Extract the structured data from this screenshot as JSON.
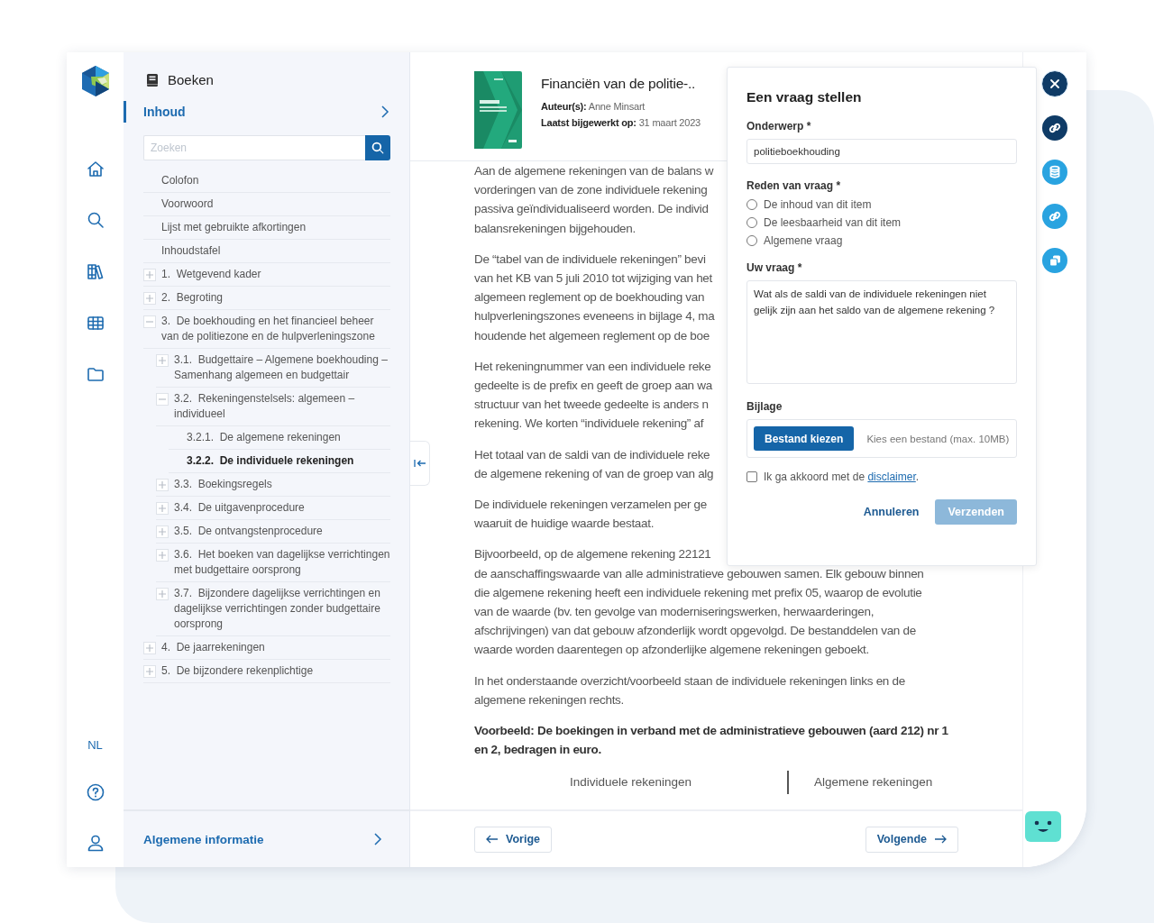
{
  "rail": {
    "language": "NL"
  },
  "sidebar": {
    "title": "Boeken",
    "tabs": [
      {
        "label": "Inhoud",
        "selected": true
      }
    ],
    "search": {
      "placeholder": "Zoeken"
    },
    "toc": [
      {
        "kind": "page",
        "label": "Colofon",
        "selected": false
      },
      {
        "kind": "page",
        "label": "Voorwoord",
        "selected": false
      },
      {
        "kind": "page",
        "label": "Lijst met gebruikte afkortingen",
        "selected": false
      },
      {
        "kind": "page",
        "label": "Inhoudstafel",
        "selected": false
      },
      {
        "kind": "chapter",
        "label": "1.  Wetgevend kader",
        "expanded": false,
        "selected": false
      },
      {
        "kind": "chapter",
        "label": "2.  Begroting",
        "expanded": false,
        "selected": false
      },
      {
        "kind": "chapter",
        "label": "3.  De boekhouding en het financieel beheer van de politiezone en de hulpverleningszone",
        "expanded": true,
        "selected": false,
        "children": [
          {
            "kind": "chapter",
            "label": "3.1.  Budgettaire – Algemene boekhouding – Samenhang algemeen en budgettair",
            "expanded": false,
            "selected": false
          },
          {
            "kind": "chapter",
            "label": "3.2.  Rekeningenstelsels: algemeen – individueel",
            "expanded": true,
            "selected": false,
            "children": [
              {
                "kind": "page",
                "label": "3.2.1.  De algemene rekeningen",
                "selected": false
              },
              {
                "kind": "page",
                "label": "3.2.2.  De individuele rekeningen",
                "selected": true
              }
            ]
          },
          {
            "kind": "chapter",
            "label": "3.3.  Boekingsregels",
            "expanded": false,
            "selected": false
          },
          {
            "kind": "chapter",
            "label": "3.4.  De uitgavenprocedure",
            "expanded": false,
            "selected": false
          },
          {
            "kind": "chapter",
            "label": "3.5.  De ontvangstenprocedure",
            "expanded": false,
            "selected": false
          },
          {
            "kind": "chapter",
            "label": "3.6.  Het boeken van dagelijkse verrichtingen met budgettaire oorsprong",
            "expanded": false,
            "selected": false
          },
          {
            "kind": "chapter",
            "label": "3.7.  Bijzondere dagelijkse verrichtingen en dagelijkse verrichtingen zonder budgettaire oorsprong",
            "expanded": false,
            "selected": false
          }
        ]
      },
      {
        "kind": "chapter",
        "label": "4.  De jaarrekeningen",
        "expanded": false,
        "selected": false
      },
      {
        "kind": "chapter",
        "label": "5.  De bijzondere rekenplichtige",
        "expanded": false,
        "selected": false
      }
    ],
    "footer_link": "Algemene informatie"
  },
  "book": {
    "title": "Financiën van de politie-..",
    "author_label": "Auteur(s):",
    "author": "Anne Minsart",
    "updated_label": "Laatst bijgewerkt op:",
    "updated": "31 maart 2023"
  },
  "content": {
    "paragraphs": [
      {
        "kind": "text",
        "lines": [
          "Aan de algemene rekeningen van de balans w",
          "vorderingen van de zone individuele rekening",
          "passiva geïndividualiseerd worden. De individ",
          "balansrekeningen bijgehouden."
        ]
      },
      {
        "kind": "text",
        "lines": [
          "De “tabel van de individuele rekeningen” bevi",
          "van het KB van 5 juli 2010 tot wijziging van het",
          "algemeen reglement op de boekhouding van",
          "hulpverleningszones eveneens in bijlage 4, ma",
          "houdende het algemeen reglement op de boe"
        ]
      },
      {
        "kind": "text",
        "lines": [
          "Het rekeningnummer van een individuele reke",
          "gedeelte is de prefix en geeft de groep aan wa",
          "structuur van het tweede gedeelte is anders n",
          "rekening. We korten “individuele rekening” af"
        ]
      },
      {
        "kind": "text",
        "lines": [
          "Het totaal van de saldi van de individuele reke",
          "de algemene rekening of van de groep van alg"
        ]
      },
      {
        "kind": "text",
        "lines": [
          "De individuele rekeningen verzamelen per ge",
          "waaruit de huidige waarde bestaat."
        ]
      },
      {
        "kind": "text",
        "lines": [
          "Bijvoorbeeld, op de algemene rekening 22121",
          "de aanschaffingswaarde van alle administratieve gebouwen samen. Elk gebouw binnen",
          "die algemene rekening heeft een individuele rekening met prefix 05, waarop de evolutie",
          "van de waarde (bv. ten gevolge van moderniseringswerken, herwaarderingen,",
          "afschrijvingen) van dat gebouw afzonderlijk wordt opgevolgd. De bestanddelen van de",
          "waarde worden daarentegen op afzonderlijke algemene rekeningen geboekt."
        ]
      },
      {
        "kind": "text",
        "lines": [
          "In het onderstaande overzicht/voorbeeld staan de individuele rekeningen links en de",
          "algemene rekeningen rechts."
        ]
      },
      {
        "kind": "bold",
        "lines": [
          "Voorbeeld: De boekingen in verband met de administratieve gebouwen (aard 212) nr 1",
          "en 2, bedragen in euro."
        ]
      }
    ],
    "table_columns": [
      "Individuele rekeningen",
      "Algemene rekeningen"
    ]
  },
  "navigation": {
    "previous": "Vorige",
    "next": "Volgende"
  },
  "question_form": {
    "title": "Een vraag stellen",
    "subject": {
      "label": "Onderwerp *",
      "value": "politieboekhouding"
    },
    "reason": {
      "label": "Reden van vraag *",
      "options": [
        {
          "label": "De inhoud van dit item",
          "selected": false
        },
        {
          "label": "De leesbaarheid van dit item",
          "selected": false
        },
        {
          "label": "Algemene vraag",
          "selected": false
        }
      ]
    },
    "question": {
      "label": "Uw vraag *",
      "value": "Wat als de saldi van de individuele rekeningen niet gelijk zijn aan het saldo van de algemene rekening ?"
    },
    "attachment": {
      "label": "Bijlage",
      "button": "Bestand kiezen",
      "hint": "Kies een bestand (max. 10MB)"
    },
    "agreement": {
      "text": "Ik ga akkoord met de ",
      "link": "disclaimer",
      "after": ".",
      "checked": false
    },
    "cancel": "Annuleren",
    "submit": {
      "label": "Verzenden",
      "disabled": true
    }
  },
  "actions": [
    {
      "kind": "close",
      "active": true
    },
    {
      "kind": "link",
      "active": true
    },
    {
      "kind": "database",
      "active": false
    },
    {
      "kind": "link",
      "active": false
    },
    {
      "kind": "copy",
      "active": false
    }
  ]
}
